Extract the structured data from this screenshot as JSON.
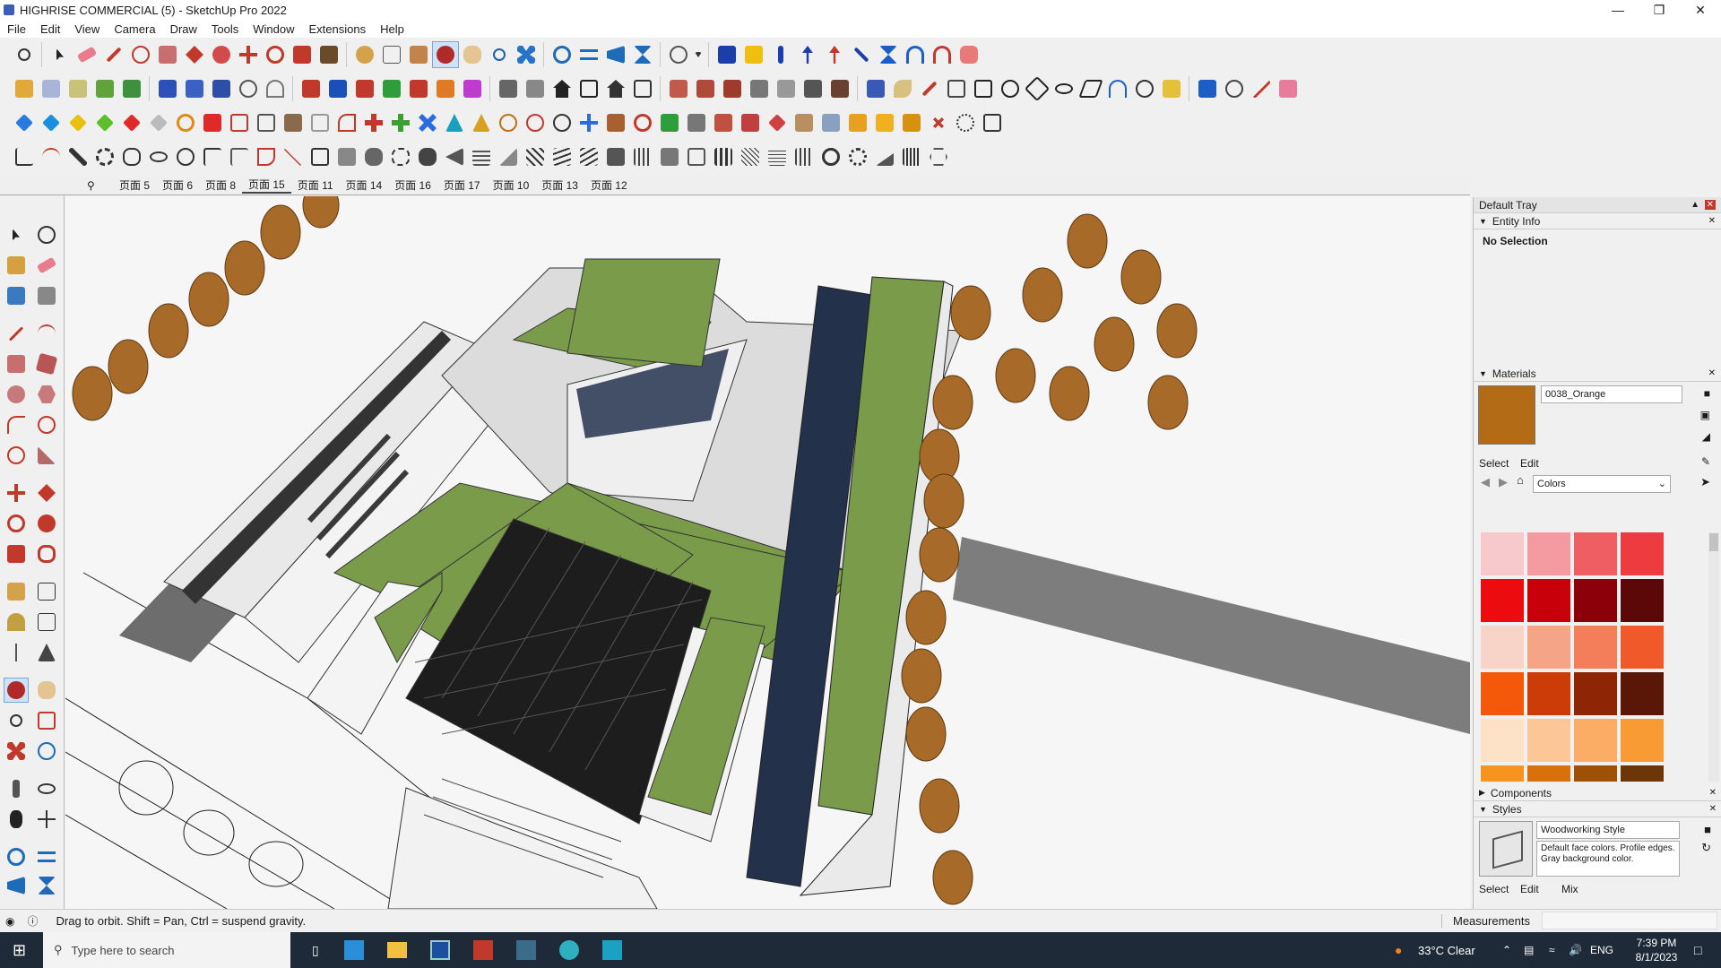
{
  "window": {
    "title": "HIGHRISE COMMERCIAL (5) - SketchUp Pro 2022"
  },
  "menu": [
    "File",
    "Edit",
    "View",
    "Camera",
    "Draw",
    "Tools",
    "Window",
    "Extensions",
    "Help"
  ],
  "scene_tabs": [
    "页面 5",
    "页面 6",
    "页面 8",
    "页面 15",
    "页面 11",
    "页面 14",
    "页面 16",
    "页面 17",
    "页面 10",
    "页面 13",
    "页面 12"
  ],
  "active_scene": "页面 15",
  "tray": {
    "title": "Default Tray",
    "entity_info": {
      "title": "Entity Info",
      "value": "No Selection"
    },
    "materials": {
      "title": "Materials",
      "material_name": "0038_Orange",
      "tabs": [
        "Select",
        "Edit"
      ],
      "library": "Colors",
      "swatch_colors": [
        "#f7c8cc",
        "#f49aa1",
        "#ef5e63",
        "#ee3b3f",
        "#ec0b0f",
        "#c8000a",
        "#8c0009",
        "#5c0808",
        "#f8d4c8",
        "#f6a488",
        "#f47e59",
        "#f05a2a",
        "#f4590b",
        "#cc3c08",
        "#8e2605",
        "#5a1606",
        "#fde2c8",
        "#fcc696",
        "#fbad66",
        "#f99b34",
        "#f79420",
        "#d8700c",
        "#9e5006",
        "#6c3608"
      ],
      "current_color": "#b36b15"
    },
    "components": {
      "title": "Components"
    },
    "styles": {
      "title": "Styles",
      "style_name": "Woodworking Style",
      "description": "Default face colors. Profile edges. Gray background color.",
      "tabs": [
        "Select",
        "Edit",
        "Mix"
      ]
    }
  },
  "status": {
    "hint": "Drag to orbit. Shift = Pan, Ctrl = suspend gravity.",
    "measurements_label": "Measurements"
  },
  "taskbar": {
    "search_placeholder": "Type here to search",
    "weather": "33°C  Clear",
    "language": "ENG",
    "time": "7:39 PM",
    "date": "8/1/2023"
  }
}
